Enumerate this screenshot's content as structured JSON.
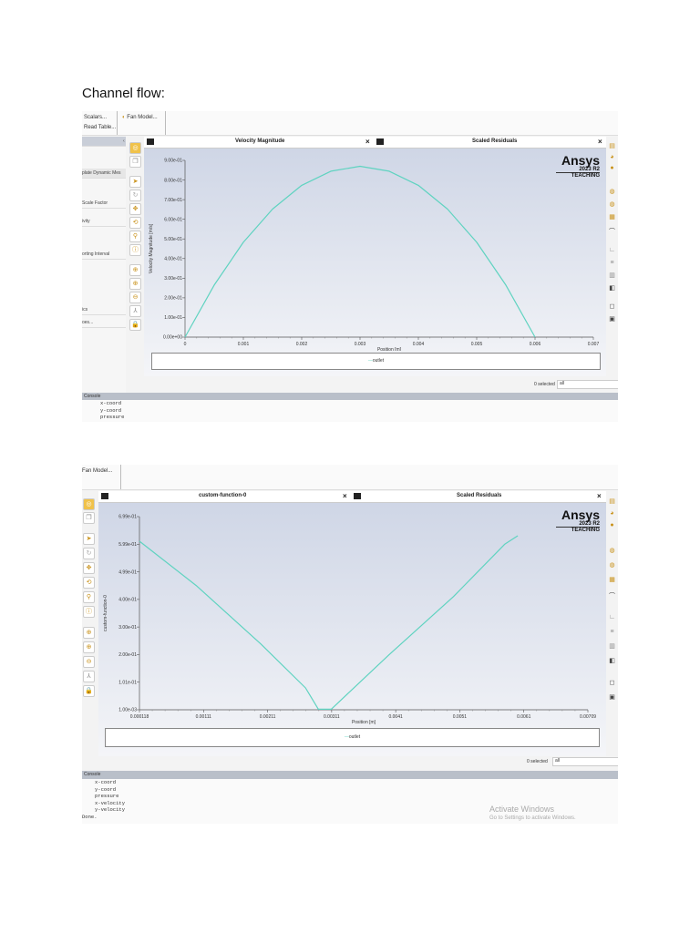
{
  "document": {
    "heading": "Channel flow:"
  },
  "shot1": {
    "toolbar": {
      "scalars": "Scalars...",
      "read_table": "Read Table...",
      "fan_model": "Fan Model..."
    },
    "left_panel": [
      "plate Dynamic Mes",
      "Scale Factor",
      "ivity",
      "orting Interval",
      "ics",
      "oes..."
    ],
    "tab_plot": "Velocity Magnitude",
    "tab_residuals": "Scaled Residuals",
    "close": "×",
    "logo": {
      "name": "Ansys",
      "version": "2023 R2",
      "edition": "TEACHING"
    },
    "legend": "outlet",
    "selected": "0 selected",
    "filter": "all",
    "console_title": "Console",
    "console_lines": [
      "x-coord",
      "y-coord",
      "pressure"
    ]
  },
  "shot2": {
    "toolbar": {
      "fan_model": "Fan Model..."
    },
    "tab_plot": "custom-function-0",
    "tab_residuals": "Scaled Residuals",
    "close": "×",
    "logo": {
      "name": "Ansys",
      "version": "2023 R2",
      "edition": "TEACHING"
    },
    "legend": "outlet",
    "selected": "0 selected",
    "filter": "all",
    "console_title": "Console",
    "console_lines": [
      "x-coord",
      "y-coord",
      "pressure",
      "x-velocity",
      "y-velocity",
      "Done."
    ],
    "watermark_title": "Activate Windows",
    "watermark_sub": "Go to Settings to activate Windows."
  },
  "chart_data": [
    {
      "type": "line",
      "title": "Velocity Magnitude",
      "xlabel": "Position [m]",
      "ylabel": "Velocity Magnitude [m/s]",
      "xlim": [
        0,
        0.007
      ],
      "ylim": [
        0,
        0.9
      ],
      "xticks": [
        "0",
        "0.001",
        "0.002",
        "0.003",
        "0.004",
        "0.005",
        "0.006",
        "0.007"
      ],
      "yticks": [
        "0.00e+00",
        "1.00e-01",
        "2.00e-01",
        "3.00e-01",
        "4.00e-01",
        "5.00e-01",
        "6.00e-01",
        "7.00e-01",
        "8.00e-01",
        "9.00e-01"
      ],
      "series": [
        {
          "name": "outlet",
          "color": "#5fd3c0",
          "x": [
            0,
            0.0005,
            0.001,
            0.0015,
            0.002,
            0.0025,
            0.003,
            0.0035,
            0.004,
            0.0045,
            0.005,
            0.0055,
            0.006
          ],
          "y": [
            0,
            0.265,
            0.483,
            0.652,
            0.773,
            0.845,
            0.87,
            0.845,
            0.773,
            0.652,
            0.483,
            0.265,
            0
          ]
        }
      ]
    },
    {
      "type": "line",
      "title": "custom-function-0",
      "xlabel": "Position [m]",
      "ylabel": "custom-function-0",
      "xlim": [
        0.000118,
        0.00709
      ],
      "ylim": [
        0.001,
        0.699
      ],
      "xticks": [
        "0.000118",
        "0.00111",
        "0.00211",
        "0.00311",
        "0.0041",
        "0.0051",
        "0.0061",
        "0.00709"
      ],
      "yticks": [
        "1.00e-03",
        "1.01e-01",
        "2.00e-01",
        "3.00e-01",
        "4.00e-01",
        "4.99e-01",
        "5.99e-01",
        "6.99e-01"
      ],
      "series": [
        {
          "name": "outlet",
          "color": "#5fd3c0",
          "x": [
            0.000118,
            0.001,
            0.002,
            0.0027,
            0.0029,
            0.0031,
            0.004,
            0.005,
            0.0058,
            0.006
          ],
          "y": [
            0.61,
            0.45,
            0.24,
            0.08,
            0.003,
            0.003,
            0.2,
            0.41,
            0.6,
            0.63
          ]
        }
      ]
    }
  ]
}
